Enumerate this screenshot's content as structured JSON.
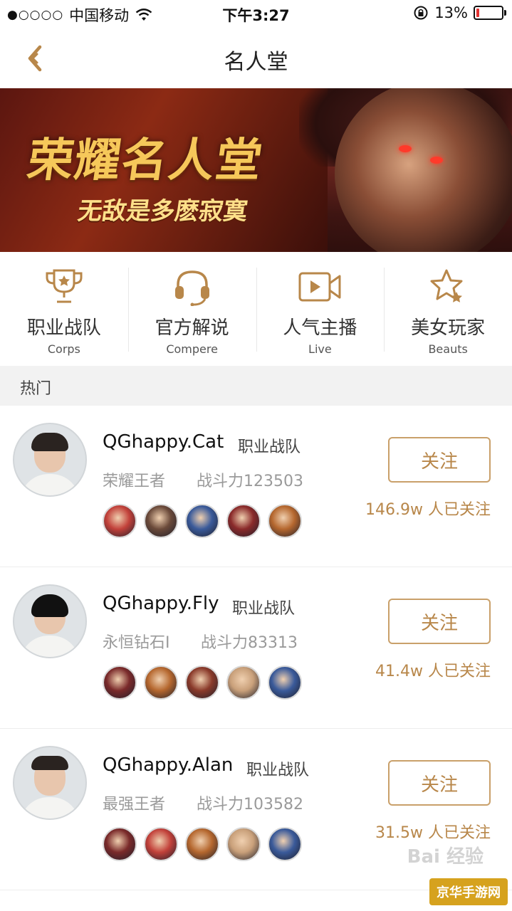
{
  "status": {
    "carrier": "中国移动",
    "signal_dots": "●○○○○",
    "time": "下午3:27",
    "battery_pct": "13%",
    "battery_level": 0.13,
    "battery_color": "#e33333"
  },
  "nav": {
    "title": "名人堂",
    "back_icon": "back-chevron-icon"
  },
  "banner": {
    "title": "荣耀名人堂",
    "subtitle": "无敌是多麽寂寞"
  },
  "categories": [
    {
      "zh": "职业战队",
      "en": "Corps",
      "icon": "trophy-icon"
    },
    {
      "zh": "官方解说",
      "en": "Compere",
      "icon": "headset-icon"
    },
    {
      "zh": "人气主播",
      "en": "Live",
      "icon": "video-icon"
    },
    {
      "zh": "美女玩家",
      "en": "Beauts",
      "icon": "star-icon"
    }
  ],
  "section_title": "热门",
  "players": [
    {
      "name": "QGhappy.Cat",
      "team": "职业战队",
      "rank": "荣耀王者",
      "power": "战斗力123503",
      "follow": "关注",
      "fans": "146.9w 人已关注",
      "heroes": [
        "#c2413a",
        "#6b4a3a",
        "#3a5a9a",
        "#8a2a2a",
        "#b5672e"
      ]
    },
    {
      "name": "QGhappy.Fly",
      "team": "职业战队",
      "rank": "永恒钻石I",
      "power": "战斗力83313",
      "follow": "关注",
      "fans": "41.4w 人已关注",
      "heroes": [
        "#7a2a2a",
        "#b5672e",
        "#8a3a2a",
        "#c9a07a",
        "#3a5a9a"
      ]
    },
    {
      "name": "QGhappy.Alan",
      "team": "职业战队",
      "rank": "最强王者",
      "power": "战斗力103582",
      "follow": "关注",
      "fans": "31.5w 人已关注",
      "heroes": [
        "#7a2a2a",
        "#c2413a",
        "#b5672e",
        "#c9a07a",
        "#3a5a9a"
      ]
    }
  ],
  "accent_color": "#c9a06a",
  "watermark": "京华手游网",
  "baidu_mark": "Bai 经验"
}
